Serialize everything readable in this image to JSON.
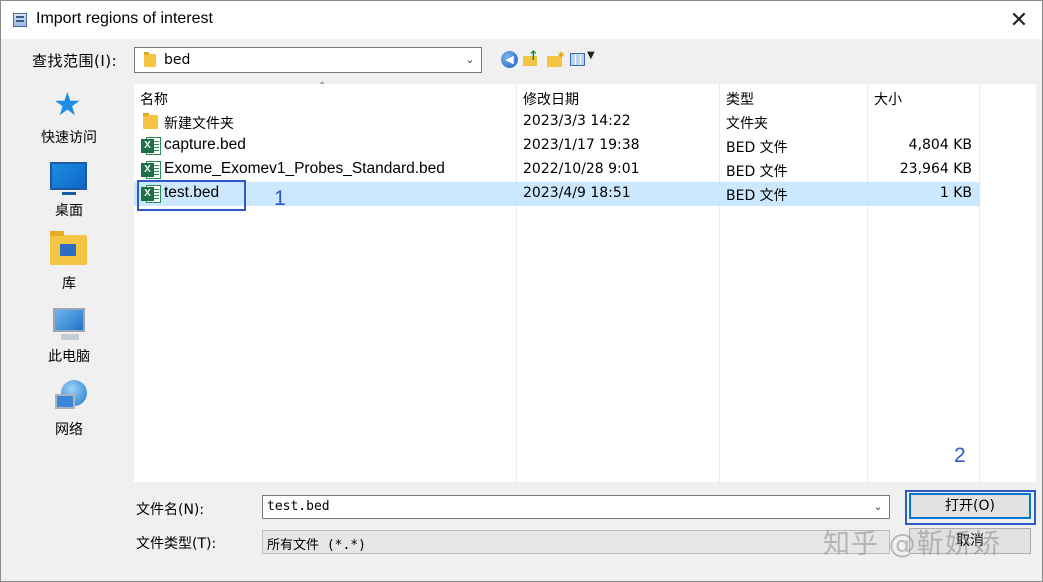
{
  "window": {
    "title": "Import regions of interest",
    "close_glyph": "✕"
  },
  "lookin": {
    "label": "查找范围(I):",
    "value": "bed"
  },
  "toolbar": {
    "icons": [
      "back-icon",
      "up-folder-icon",
      "new-folder-icon",
      "view-menu-icon"
    ]
  },
  "places": [
    {
      "label": "快速访问",
      "icon": "star-icon"
    },
    {
      "label": "桌面",
      "icon": "desktop-icon"
    },
    {
      "label": "库",
      "icon": "library-icon"
    },
    {
      "label": "此电脑",
      "icon": "computer-icon"
    },
    {
      "label": "网络",
      "icon": "network-icon"
    }
  ],
  "columns": {
    "name": "名称",
    "modified": "修改日期",
    "type": "类型",
    "size": "大小"
  },
  "files": [
    {
      "name": "新建文件夹",
      "modified": "2023/3/3 14:22",
      "type": "文件夹",
      "size": "",
      "icon": "folder-icon"
    },
    {
      "name": "capture.bed",
      "modified": "2023/1/17 19:38",
      "type": "BED 文件",
      "size": "4,804 KB",
      "icon": "excel-file-icon"
    },
    {
      "name": "Exome_Exomev1_Probes_Standard.bed",
      "modified": "2022/10/28 9:01",
      "type": "BED 文件",
      "size": "23,964 KB",
      "icon": "excel-file-icon"
    },
    {
      "name": "test.bed",
      "modified": "2023/4/9 18:51",
      "type": "BED 文件",
      "size": "1 KB",
      "icon": "excel-file-icon",
      "selected": true
    }
  ],
  "annotations": {
    "one": "1",
    "two": "2"
  },
  "filename": {
    "label": "文件名(N):",
    "value": "test.bed"
  },
  "filetype": {
    "label": "文件类型(T):",
    "value": "所有文件 (*.*)"
  },
  "buttons": {
    "open": "打开(O)",
    "cancel": "取消"
  },
  "watermark": "知乎 @靳娇娇",
  "colors": {
    "selection": "#cce8ff",
    "annotation": "#2f58c9",
    "default_button_border": "#0078d7"
  }
}
